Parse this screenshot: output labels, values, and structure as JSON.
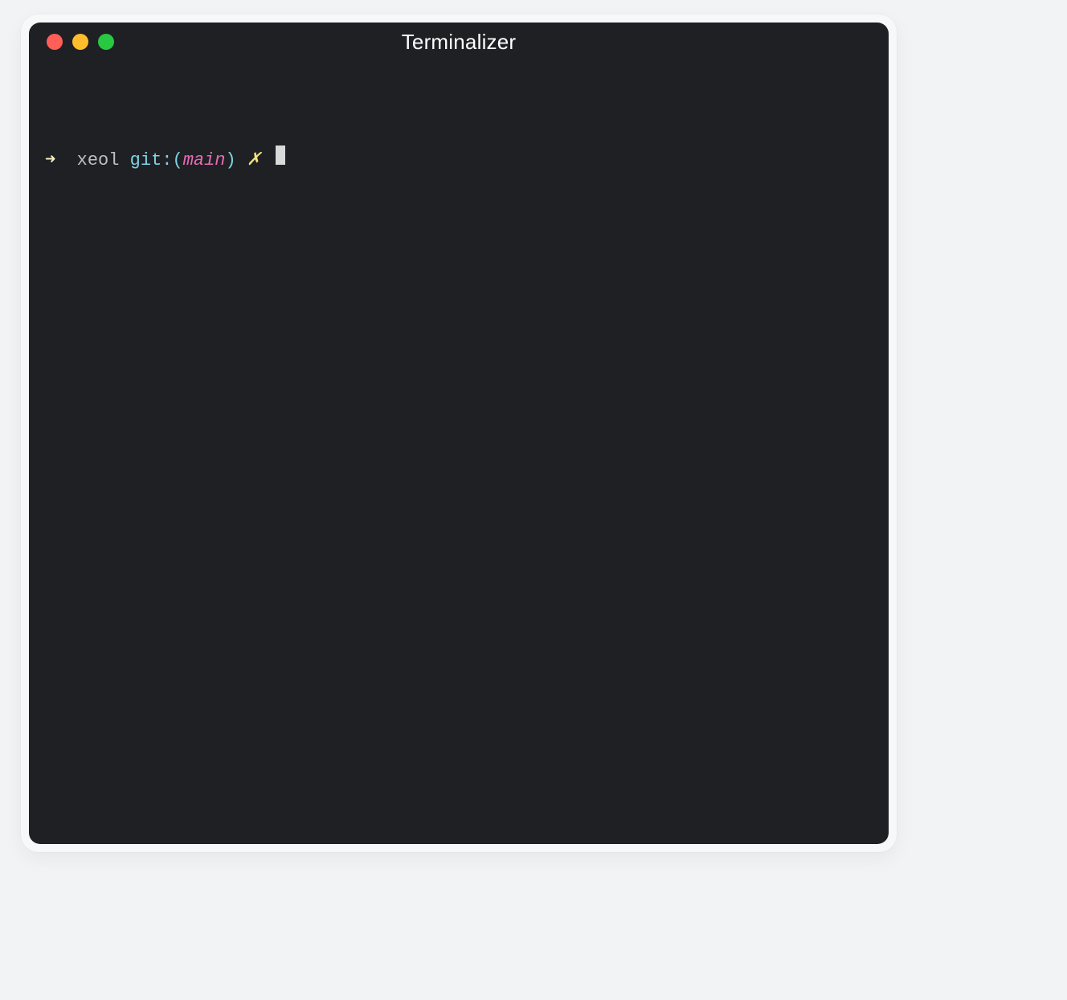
{
  "window": {
    "title": "Terminalizer"
  },
  "prompt": {
    "arrow": "➜",
    "cwd": "xeol",
    "git_label": "git:",
    "paren_open": "(",
    "branch": "main",
    "paren_close": ")",
    "dirty_marker": "✗",
    "command": ""
  }
}
